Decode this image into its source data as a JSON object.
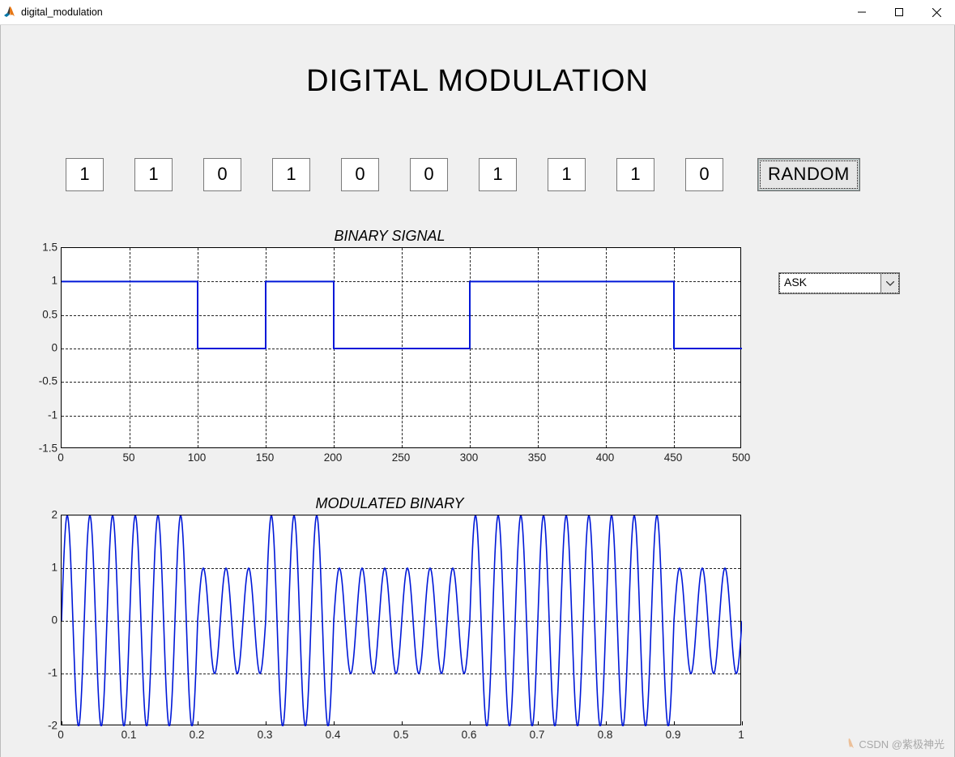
{
  "window": {
    "title": "digital_modulation"
  },
  "heading": "DIGITAL MODULATION",
  "bits": [
    "1",
    "1",
    "0",
    "1",
    "0",
    "0",
    "1",
    "1",
    "1",
    "0"
  ],
  "random_label": "RANDOM",
  "dropdown": {
    "selected": "ASK"
  },
  "plots": {
    "binary": {
      "title": "BINARY SIGNAL",
      "yticks": [
        "1.5",
        "1",
        "0.5",
        "0",
        "-0.5",
        "-1",
        "-1.5"
      ],
      "xticks": [
        "0",
        "50",
        "100",
        "150",
        "200",
        "250",
        "300",
        "350",
        "400",
        "450",
        "500"
      ],
      "ylim": [
        -1.5,
        1.5
      ],
      "xlim": [
        0,
        500
      ]
    },
    "modulated": {
      "title": "MODULATED BINARY",
      "yticks": [
        "2",
        "1",
        "0",
        "-1",
        "-2"
      ],
      "xticks": [
        "0",
        "0.1",
        "0.2",
        "0.3",
        "0.4",
        "0.5",
        "0.6",
        "0.7",
        "0.8",
        "0.9",
        "1"
      ],
      "ylim": [
        -2,
        2
      ],
      "xlim": [
        0,
        1
      ]
    }
  },
  "watermark": "CSDN @紫极神光",
  "chart_data": [
    {
      "type": "line",
      "title": "BINARY SIGNAL",
      "xlabel": "",
      "ylabel": "",
      "xlim": [
        0,
        500
      ],
      "ylim": [
        -1.5,
        1.5
      ],
      "description": "Step signal of bit sequence, 50 samples per bit",
      "bits": [
        1,
        1,
        0,
        1,
        0,
        0,
        1,
        1,
        1,
        0
      ],
      "samples_per_bit": 50
    },
    {
      "type": "line",
      "title": "MODULATED BINARY",
      "xlabel": "",
      "ylabel": "",
      "xlim": [
        0,
        1
      ],
      "ylim": [
        -2,
        2
      ],
      "description": "ASK-modulated carrier: amplitude 2 for bit=1, amplitude 1 for bit=0, ~3 carrier cycles per bit period of 0.1",
      "bits": [
        1,
        1,
        0,
        1,
        0,
        0,
        1,
        1,
        1,
        0
      ],
      "bit_period": 0.1,
      "carrier_cycles_per_bit": 3,
      "amp_high": 2,
      "amp_low": 1
    }
  ]
}
